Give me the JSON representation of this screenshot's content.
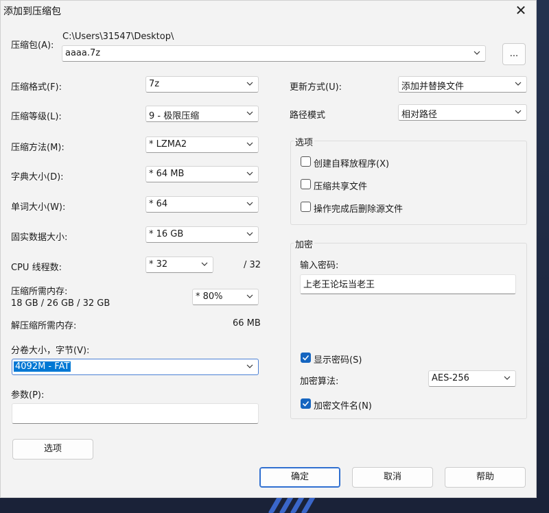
{
  "window": {
    "title": "添加到压缩包",
    "close_glyph": "✕"
  },
  "archive": {
    "label": "压缩包(A):",
    "path": "C:\\Users\\31547\\Desktop\\",
    "filename": "aaaa.7z",
    "browse_label": "..."
  },
  "left": {
    "format": {
      "label": "压缩格式(F):",
      "value": "7z"
    },
    "level": {
      "label": "压缩等级(L):",
      "value": "9 - 极限压缩"
    },
    "method": {
      "label": "压缩方法(M):",
      "value": "*  LZMA2"
    },
    "dict": {
      "label": "字典大小(D):",
      "value": "*  64 MB"
    },
    "word": {
      "label": "单词大小(W):",
      "value": "*  64"
    },
    "solid": {
      "label": "固实数据大小:",
      "value": "*  16 GB"
    },
    "threads": {
      "label": "CPU 线程数:",
      "value": "*  32",
      "max": "/ 32"
    },
    "mem_compress": {
      "label": "压缩所需内存:",
      "detail": "18 GB / 26 GB / 32 GB",
      "value": "*  80%"
    },
    "mem_decompress": {
      "label": "解压缩所需内存:",
      "value": "66 MB"
    },
    "volume": {
      "label": "分卷大小，字节(V):",
      "value": "4092M - FAT"
    },
    "params": {
      "label": "参数(P):",
      "value": ""
    },
    "options_button": "选项"
  },
  "right": {
    "update": {
      "label": "更新方式(U):",
      "value": "添加并替换文件"
    },
    "path_mode": {
      "label": "路径模式",
      "value": "相对路径"
    },
    "options_group": {
      "title": "选项",
      "items": [
        {
          "label": "创建自释放程序(X)",
          "checked": false
        },
        {
          "label": "压缩共享文件",
          "checked": false
        },
        {
          "label": "操作完成后删除源文件",
          "checked": false
        }
      ]
    },
    "encryption": {
      "title": "加密",
      "password_label": "输入密码:",
      "password": "上老王论坛当老王",
      "show_password": {
        "label": "显示密码(S)",
        "checked": true
      },
      "method_label": "加密算法:",
      "method_value": "AES-256",
      "encrypt_names": {
        "label": "加密文件名(N)",
        "checked": true
      }
    }
  },
  "buttons": {
    "ok": "确定",
    "cancel": "取消",
    "help": "帮助"
  },
  "colors": {
    "accent": "#0078d4",
    "checkbox": "#1565c0",
    "dialog_bg": "#f3f3f3"
  }
}
